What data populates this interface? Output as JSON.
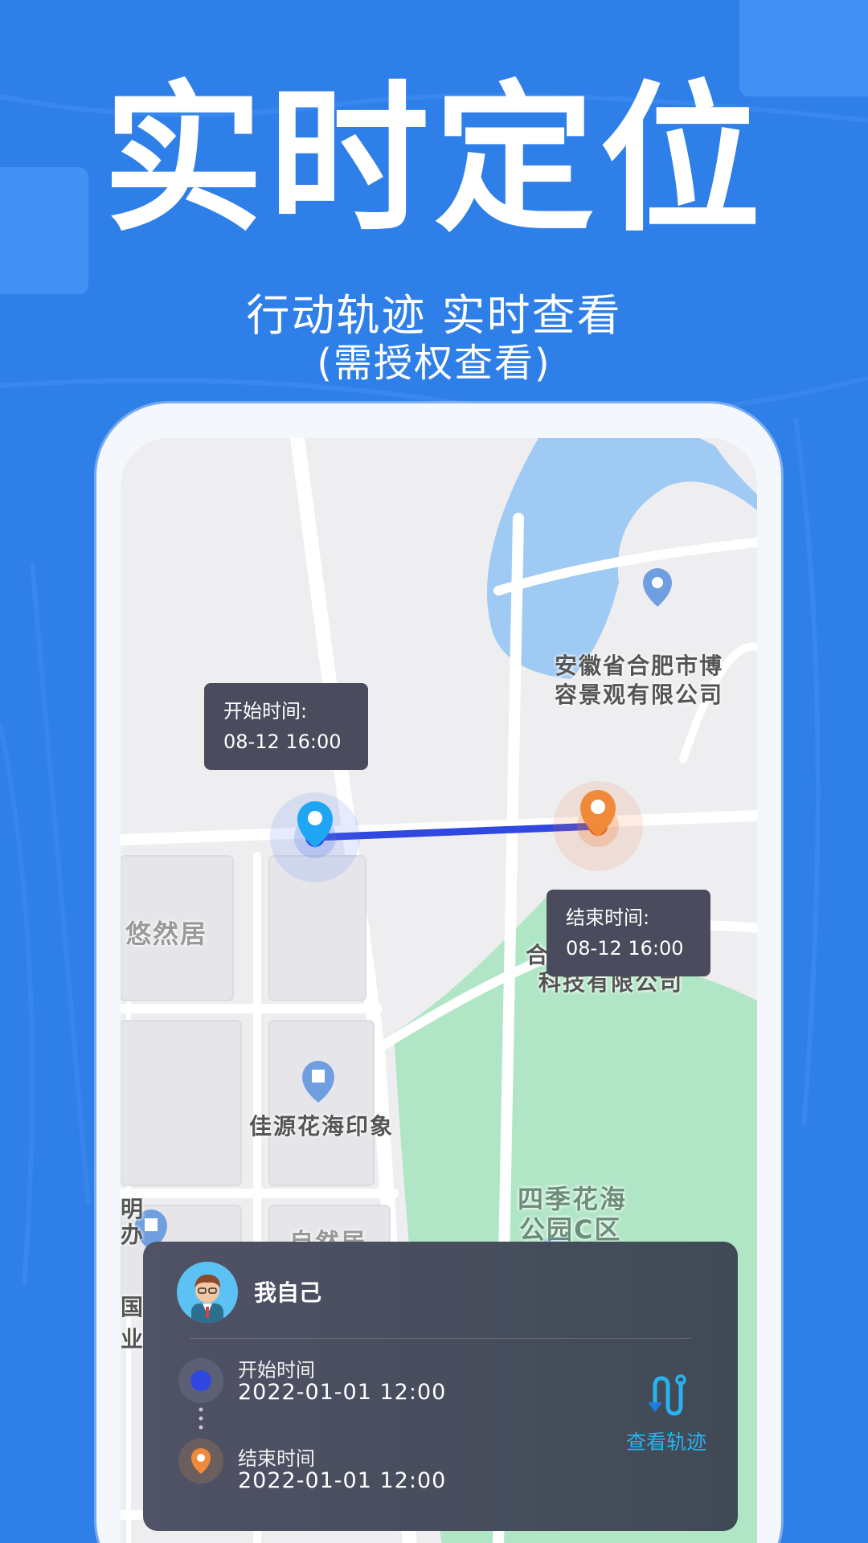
{
  "headline": "实时定位",
  "subtitle_line1": "行动轨迹 实时查看",
  "subtitle_line2": "(需授权查看)",
  "map": {
    "labels": [
      "安徽省合肥市博",
      "容景观有限公司",
      "悠然居",
      "佳源花海印象",
      "四季花海",
      "公园C区",
      "科技有限公司",
      "合",
      "自然居",
      "明",
      "办",
      "国",
      "业"
    ]
  },
  "start_tooltip": {
    "label": "开始时间:",
    "time": "08-12 16:00"
  },
  "end_tooltip": {
    "label": "结束时间:",
    "time": "08-12 16:00"
  },
  "card": {
    "user_name": "我自己",
    "start_label": "开始时间",
    "start_value": "2022-01-01 12:00",
    "end_label": "结束时间",
    "end_value": "2022-01-01 12:00",
    "view_track_label": "查看轨迹"
  },
  "colors": {
    "background": "#2f7fe9",
    "start_pin": "#1ea6f5",
    "end_pin": "#f07a30",
    "route": "#3048e0",
    "accent": "#27b3f0"
  }
}
